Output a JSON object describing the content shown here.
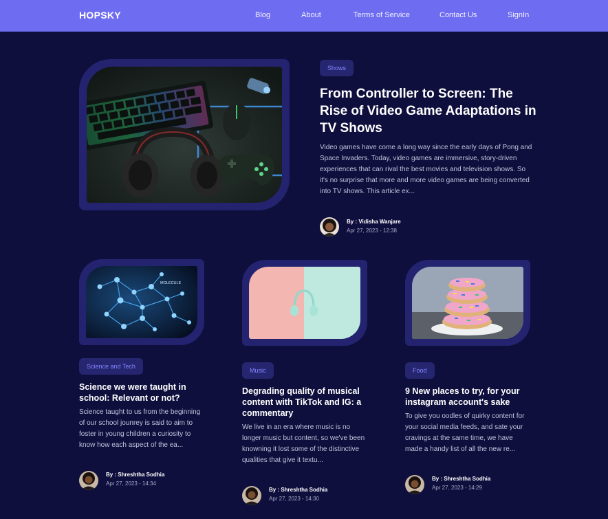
{
  "brand": {
    "logo": "HOPSKY"
  },
  "nav": {
    "links": [
      "Blog",
      "About",
      "Terms of Service",
      "Contact Us",
      "SignIn"
    ]
  },
  "featured": {
    "tag": "Shows",
    "title": "From Controller to Screen: The Rise of Video Game Adaptations in TV Shows",
    "excerpt": "Video games have come a long way since the early days of Pong and Space Invaders. Today, video games are immersive, story-driven experiences that can rival the best movies and television shows. So it's no surprise that more and more video games are being converted into TV shows. This article ex...",
    "author": "By : Vidisha Wanjare",
    "date": "Apr 27, 2023 - 12:38",
    "image_icon": "gaming-setup-image"
  },
  "posts": [
    {
      "tag": "Science and Tech",
      "title": "Science we were taught in school: Relevant or not?",
      "excerpt": "Science taught to us from the beginning of our school jounrey is said to aim to foster in young children a curiosity to know how each aspect of the ea...",
      "author": "By : Shreshtha Sodhia",
      "date": "Apr 27, 2023 - 14:34",
      "image_label": "MOLECULE"
    },
    {
      "tag": "Music",
      "title": "Degrading quality of musical content with TikTok and IG: a commentary",
      "excerpt": "We live in an era where music is no longer music but content, so we've been knowning it lost some of the distinctive qualities that give it textu...",
      "author": "By : Shreshtha Sodhia",
      "date": "Apr 27, 2023 - 14:30",
      "image_icon": "headphones-image"
    },
    {
      "tag": "Food",
      "title": "9 New places to try, for your instagram account's sake",
      "excerpt": "To give you oodles of quirky content for your social media feeds, and sate your cravings at the same time, we have made a handy list of all the new re...",
      "author": "By : Shreshtha Sodhia",
      "date": "Apr 27, 2023 - 14:29",
      "image_icon": "donuts-image"
    }
  ],
  "colors": {
    "background": "#0f0f3e",
    "navbar": "#6e6cf0",
    "frame": "#232370",
    "tag_bg": "#262670",
    "tag_text": "#8585ff"
  }
}
